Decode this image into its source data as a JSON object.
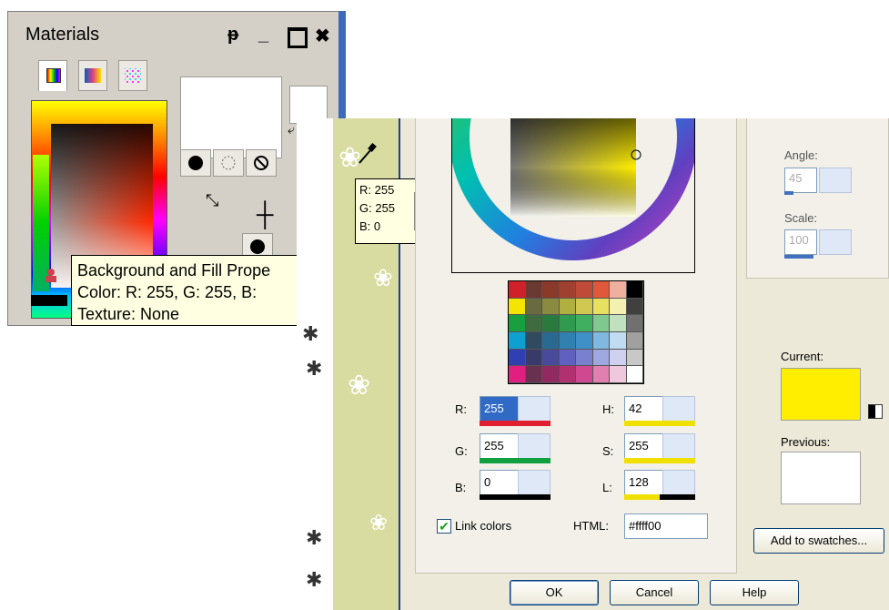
{
  "materials": {
    "title": "Materials",
    "title_buttons": [
      "pin-icon",
      "minimize-icon",
      "maximize-icon",
      "close-icon"
    ],
    "tooltip": {
      "line1": "Background and Fill Prope",
      "line2": "Color: R: 255, G: 255, B:",
      "line3": "Texture: None"
    }
  },
  "picker_tooltip": {
    "r": "R: 255",
    "g": "G: 255",
    "b": "B: 0",
    "swatch": "#ffee00"
  },
  "dialog": {
    "angle_label": "Angle:",
    "angle_value": "45",
    "scale_label": "Scale:",
    "scale_value": "100",
    "r_label": "R:",
    "r_value": "255",
    "g_label": "G:",
    "g_value": "255",
    "b_label": "B:",
    "b_value": "0",
    "h_label": "H:",
    "h_value": "42",
    "s_label": "S:",
    "s_value": "255",
    "l_label": "L:",
    "l_value": "128",
    "link_colors": "Link colors",
    "html_label": "HTML:",
    "html_value": "#ffff00",
    "current_label": "Current:",
    "current_color": "#ffee00",
    "previous_label": "Previous:",
    "previous_color": "#ffffff",
    "add_swatches": "Add to swatches...",
    "ok": "OK",
    "cancel": "Cancel",
    "help": "Help"
  },
  "palette_colors": [
    "#d0202a",
    "#6a3a32",
    "#8a3a2a",
    "#a04030",
    "#c04a38",
    "#e0583a",
    "#f0b0a0",
    "#000000",
    "#f5e400",
    "#6a6a40",
    "#8a8a40",
    "#b0b040",
    "#d0c850",
    "#e8e060",
    "#f4f0b0",
    "#404040",
    "#18a040",
    "#406a40",
    "#2a7a40",
    "#309a50",
    "#40b060",
    "#80c890",
    "#c0e0c0",
    "#707070",
    "#10a0d0",
    "#304a60",
    "#2a6a90",
    "#3080b0",
    "#4090c8",
    "#80b8e0",
    "#c0dcf0",
    "#a0a0a0",
    "#3040b0",
    "#3a3a6a",
    "#4a4a9a",
    "#6060c0",
    "#7a80d0",
    "#a0a8e0",
    "#d0d0f0",
    "#c8c8c8",
    "#e02080",
    "#6a3050",
    "#902a60",
    "#b03070",
    "#d04890",
    "#e080b0",
    "#f0c8dc",
    "#ffffff"
  ]
}
